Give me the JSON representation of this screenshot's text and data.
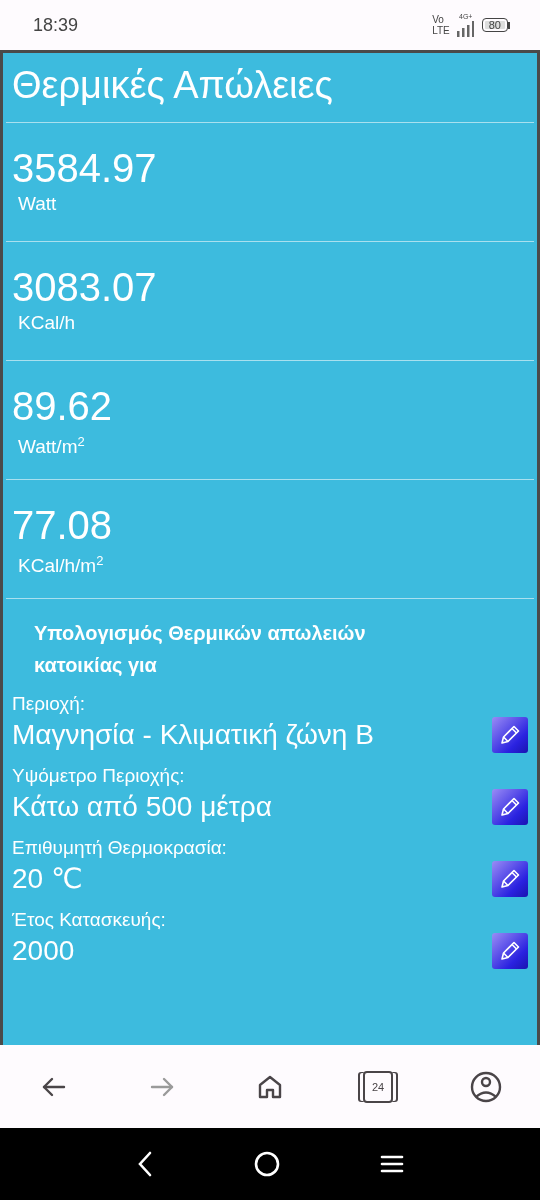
{
  "status_bar": {
    "time": "18:39",
    "network_top": "Vo",
    "network_bottom": "LTE",
    "data_type": "4G+",
    "battery": "80"
  },
  "title": "Θερμικές Απώλειες",
  "results": [
    {
      "value": "3584.97",
      "unit": "Watt"
    },
    {
      "value": "3083.07",
      "unit": "KCal/h"
    },
    {
      "value": "89.62",
      "unit": "Watt/m$^{2}$"
    },
    {
      "value": "77.08",
      "unit": "KCal/h/m$^{2}$"
    }
  ],
  "details": {
    "heading": "Υπολογισμός Θερμικών απωλειών κατοικίας για",
    "fields": [
      {
        "label": "Περιοχή:",
        "value": "Μαγνησία - Κλιματική ζώνη Β"
      },
      {
        "label": "Υψόμετρο Περιοχής:",
        "value": "Κάτω από 500 μέτρα"
      },
      {
        "label": "Επιθυμητή Θερμοκρασία:",
        "value": "20 ℃"
      },
      {
        "label": "Έτος Κατασκευής:",
        "value": "2000"
      }
    ]
  },
  "browser_toolbar": [
    {
      "kind": "back",
      "disabled": false
    },
    {
      "kind": "forward",
      "disabled": true
    },
    {
      "kind": "home",
      "disabled": false
    },
    {
      "kind": "tabs",
      "count": "24",
      "disabled": false
    },
    {
      "kind": "account",
      "disabled": false
    }
  ],
  "system_nav": [
    {
      "kind": "back"
    },
    {
      "kind": "home"
    },
    {
      "kind": "recents"
    }
  ]
}
